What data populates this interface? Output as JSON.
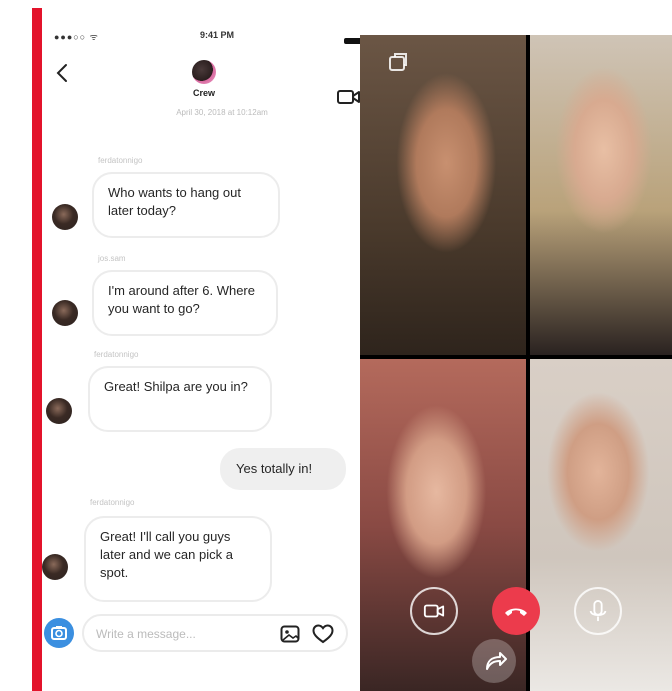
{
  "status_bar": {
    "signal": "●●●○○ ᯤ",
    "time": "9:41 PM"
  },
  "thread": {
    "title": "Crew",
    "date_divider": "April 30, 2018 at 10:12am"
  },
  "messages": [
    {
      "sender": "ferdatonnigo",
      "text": "Who wants to hang out later today?",
      "mine": false
    },
    {
      "sender": "jos.sam",
      "text": "I'm around after 6. Where you want to go?",
      "mine": false
    },
    {
      "sender": "ferdatonnigo",
      "text": "Great! Shilpa are you in?",
      "mine": false
    },
    {
      "sender": "",
      "text": "Yes totally in!",
      "mine": true
    },
    {
      "sender": "ferdatonnigo",
      "text": "Great! I'll call you guys later and we can pick a spot.",
      "mine": false
    }
  ],
  "composer": {
    "placeholder": "Write a message..."
  },
  "icons": {
    "back": "back-chevron-icon",
    "video": "video-call-icon",
    "camera": "camera-icon",
    "gallery": "gallery-icon",
    "heart": "heart-icon",
    "flip": "flip-camera-icon",
    "video_toggle": "video-toggle-icon",
    "end_call": "end-call-icon",
    "mic": "microphone-icon",
    "share": "share-icon"
  },
  "colors": {
    "accent_red": "#e3132b",
    "end_call": "#ec3b4c",
    "camera_blue": "#3b8fe0"
  }
}
